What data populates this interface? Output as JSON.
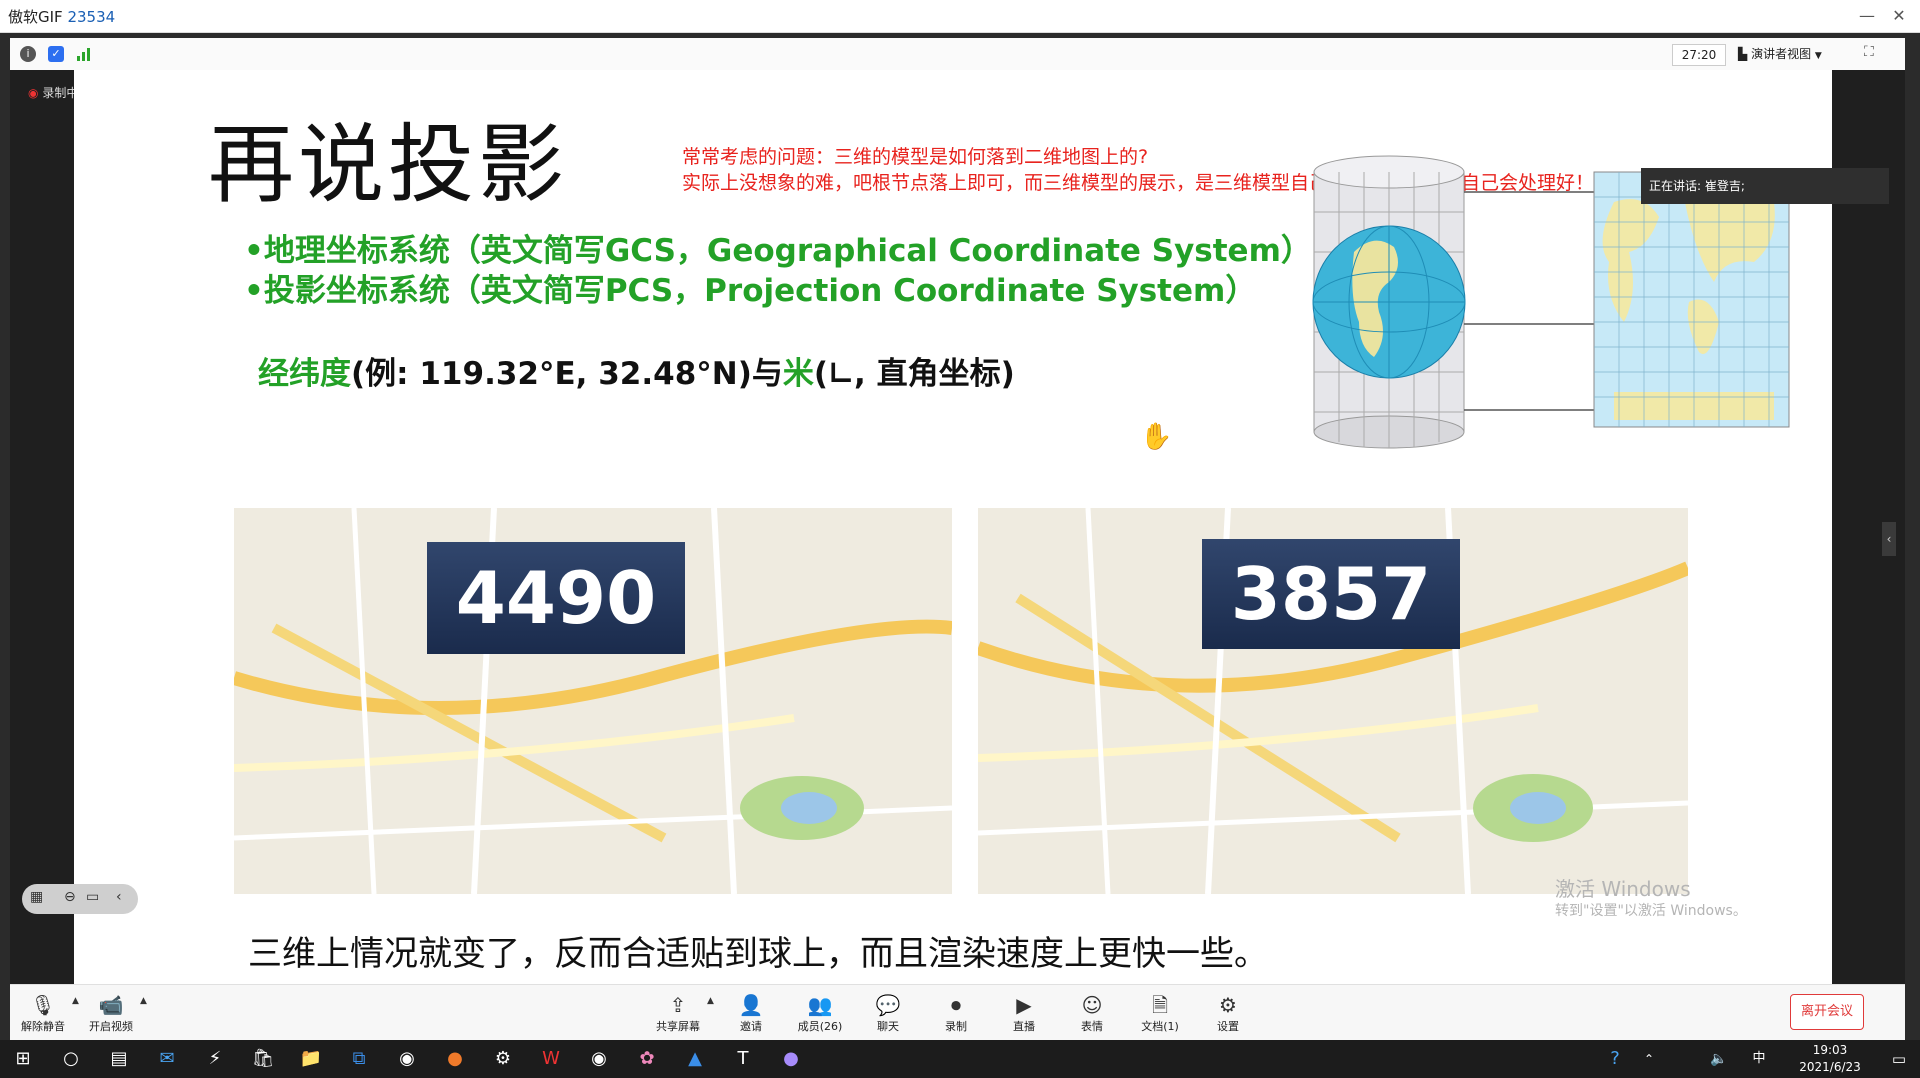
{
  "window": {
    "title": "傲软GIF",
    "title_number": "23534"
  },
  "meeting_bar": {
    "timer": "27:20",
    "view_label": "演讲者视图",
    "recording_label": "录制中"
  },
  "speaking": {
    "label": "正在讲话:",
    "name": "崔登吉;"
  },
  "slide": {
    "title": "再说投影",
    "note_line1": "常常考虑的问题：三维的模型是如何落到二维地图上的?",
    "note_line2": "实际上没想象的难，吧根节点落上即可，而三维模型的展示，是三维模型自己本身的事情！它自己会处理好！",
    "bullet1": "•地理坐标系统（英文简写GCS，Geographical Coordinate System）",
    "bullet2": "•投影坐标系统（英文简写PCS，Projection Coordinate System）",
    "coord_part1": "经纬度",
    "coord_part2": "(例: 119.32°E, 32.48°N)与",
    "coord_part3": "米",
    "coord_part4": "(∟, 直角坐标)",
    "map_left_label": "4490",
    "map_right_label": "3857",
    "bottom_text": "三维上情况就变了，反而合适贴到球上，而且渲染速度上更快一些。"
  },
  "watermark": {
    "line1": "激活 Windows",
    "line2": "转到\"设置\"以激活 Windows。"
  },
  "toolbar": {
    "unmute": "解除静音",
    "start_video": "开启视频",
    "share_screen": "共享屏幕",
    "invite": "邀请",
    "members": "成员(26)",
    "chat": "聊天",
    "record": "录制",
    "live": "直播",
    "reactions": "表情",
    "documents": "文档(1)",
    "settings": "设置",
    "leave": "离开会议"
  },
  "taskbar": {
    "time": "19:03",
    "date": "2021/6/23",
    "ime": "中"
  },
  "colors": {
    "accent_red": "#e8231e",
    "green": "#23a127",
    "badge": "#31466d"
  }
}
